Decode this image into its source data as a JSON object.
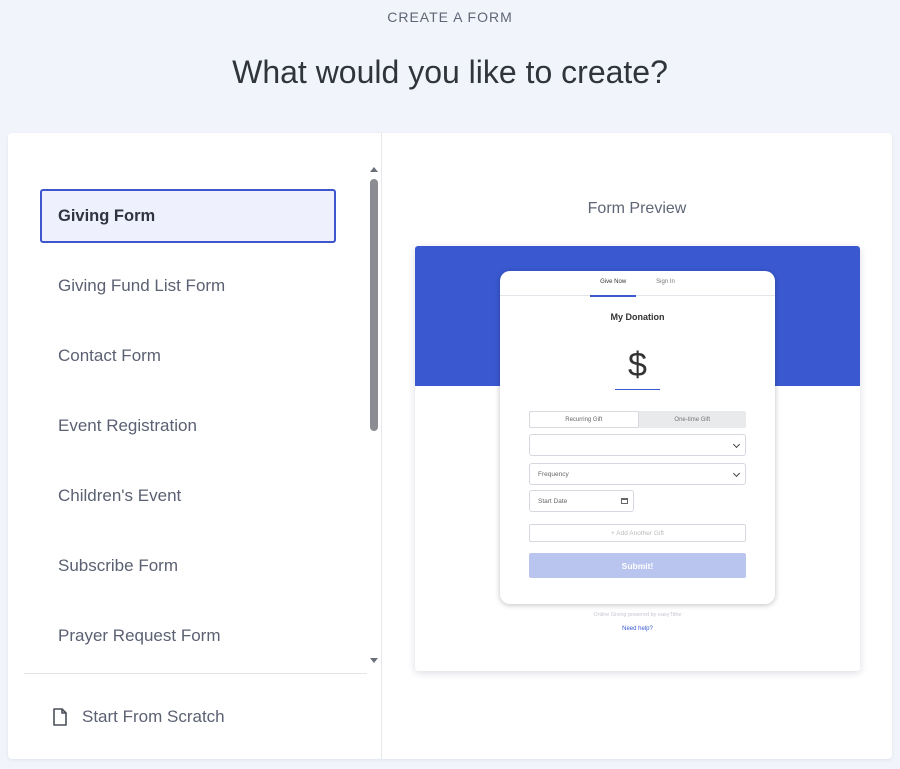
{
  "header": {
    "eyebrow": "CREATE A FORM",
    "title": "What would you like to create?"
  },
  "form_types": [
    {
      "label": "Giving Form",
      "selected": true
    },
    {
      "label": "Giving Fund List Form",
      "selected": false
    },
    {
      "label": "Contact Form",
      "selected": false
    },
    {
      "label": "Event Registration",
      "selected": false
    },
    {
      "label": "Children's Event",
      "selected": false
    },
    {
      "label": "Subscribe Form",
      "selected": false
    },
    {
      "label": "Prayer Request Form",
      "selected": false
    }
  ],
  "scratch": {
    "label": "Start From Scratch",
    "icon": "document-icon"
  },
  "preview": {
    "title": "Form Preview",
    "tabs": [
      "Give Now",
      "Sign In"
    ],
    "form_title": "My Donation",
    "currency_symbol": "$",
    "gift_types": [
      "Recurring Gift",
      "One-time Gift"
    ],
    "fund_select": "",
    "frequency_placeholder": "Frequency",
    "start_date_placeholder": "Start Date",
    "add_gift_label": "+ Add Another Gift",
    "submit_label": "Submit!",
    "powered_by": "Online Giving powered by easyTithe",
    "help_link": "Need help?"
  },
  "colors": {
    "accent": "#3a59d1",
    "selected_border": "#3e55cc",
    "selected_bg": "#eef1fd",
    "page_bg": "#f1f4fb"
  }
}
